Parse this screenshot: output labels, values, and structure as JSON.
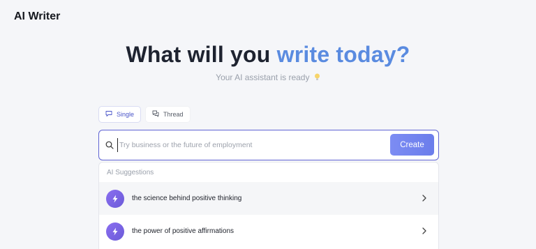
{
  "app": {
    "title": "AI Writer"
  },
  "hero": {
    "title_lead": "What will you",
    "title_accent": "write today?",
    "subtitle": "Your AI assistant is ready",
    "accent_color": "#5a8be0"
  },
  "tabs": [
    {
      "label": "Single",
      "icon": "message-icon",
      "active": true
    },
    {
      "label": "Thread",
      "icon": "messages-icon",
      "active": false
    }
  ],
  "search": {
    "placeholder": "Try business or the future of employment",
    "value": "",
    "button_label": "Create",
    "border_color": "#5f63d3"
  },
  "suggestions": {
    "header": "AI Suggestions",
    "items": [
      {
        "label": "the science behind positive thinking",
        "icon": "bolt-icon"
      },
      {
        "label": "the power of positive affirmations",
        "icon": "bolt-icon"
      }
    ]
  }
}
